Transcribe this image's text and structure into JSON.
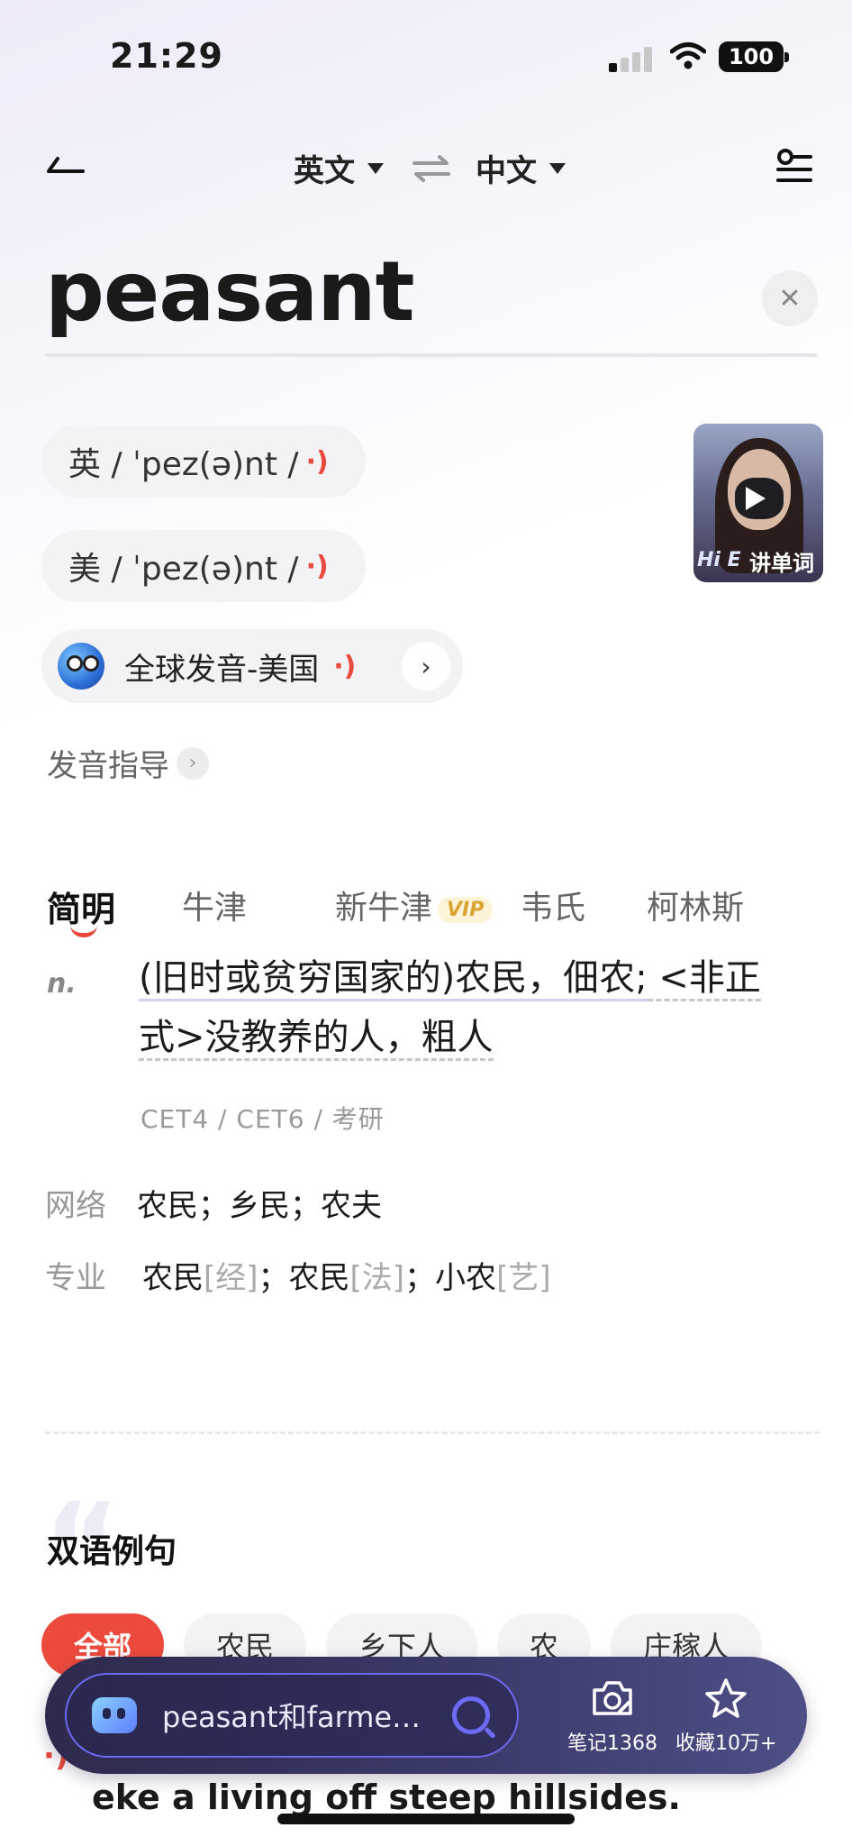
{
  "status": {
    "time": "21:29",
    "battery": "100"
  },
  "header": {
    "source_lang": "英文",
    "target_lang": "中文"
  },
  "word": "peasant",
  "pronunciations": [
    {
      "text": "英 / ˈpez(ə)nt /"
    },
    {
      "text": "美 / ˈpez(ə)nt /"
    }
  ],
  "global_pron": "全球发音-美国",
  "video_label": "讲单词",
  "video_badge": "Hi E",
  "guide": "发音指导",
  "tabs": [
    "简明",
    "牛津",
    "新牛津",
    "韦氏",
    "柯林斯"
  ],
  "vip": "VIP",
  "definition": {
    "pos": "n.",
    "part1": "(旧时或贫穷国家的)农民，佃农;",
    "part2": " <非正",
    "part3": "式>没教养的人，粗人",
    "exams": "CET4 / CET6 / 考研"
  },
  "web": {
    "label": "网络",
    "text": "农民；乡民；农夫"
  },
  "pro": {
    "label": "专业",
    "items": [
      {
        "word": "农民",
        "tag": "[经]"
      },
      {
        "word": "；农民",
        "tag": "[法]"
      },
      {
        "word": "；小农",
        "tag": "[艺]"
      }
    ]
  },
  "examples": {
    "title": "双语例句",
    "chips": [
      "全部",
      "农民",
      "乡下人",
      "农",
      "庄稼人"
    ],
    "sentence": "eke a living off steep hillsides."
  },
  "bottom_bar": {
    "search": "peasant和farme…",
    "notes": "笔记1368",
    "favorites": "收藏10万+"
  }
}
